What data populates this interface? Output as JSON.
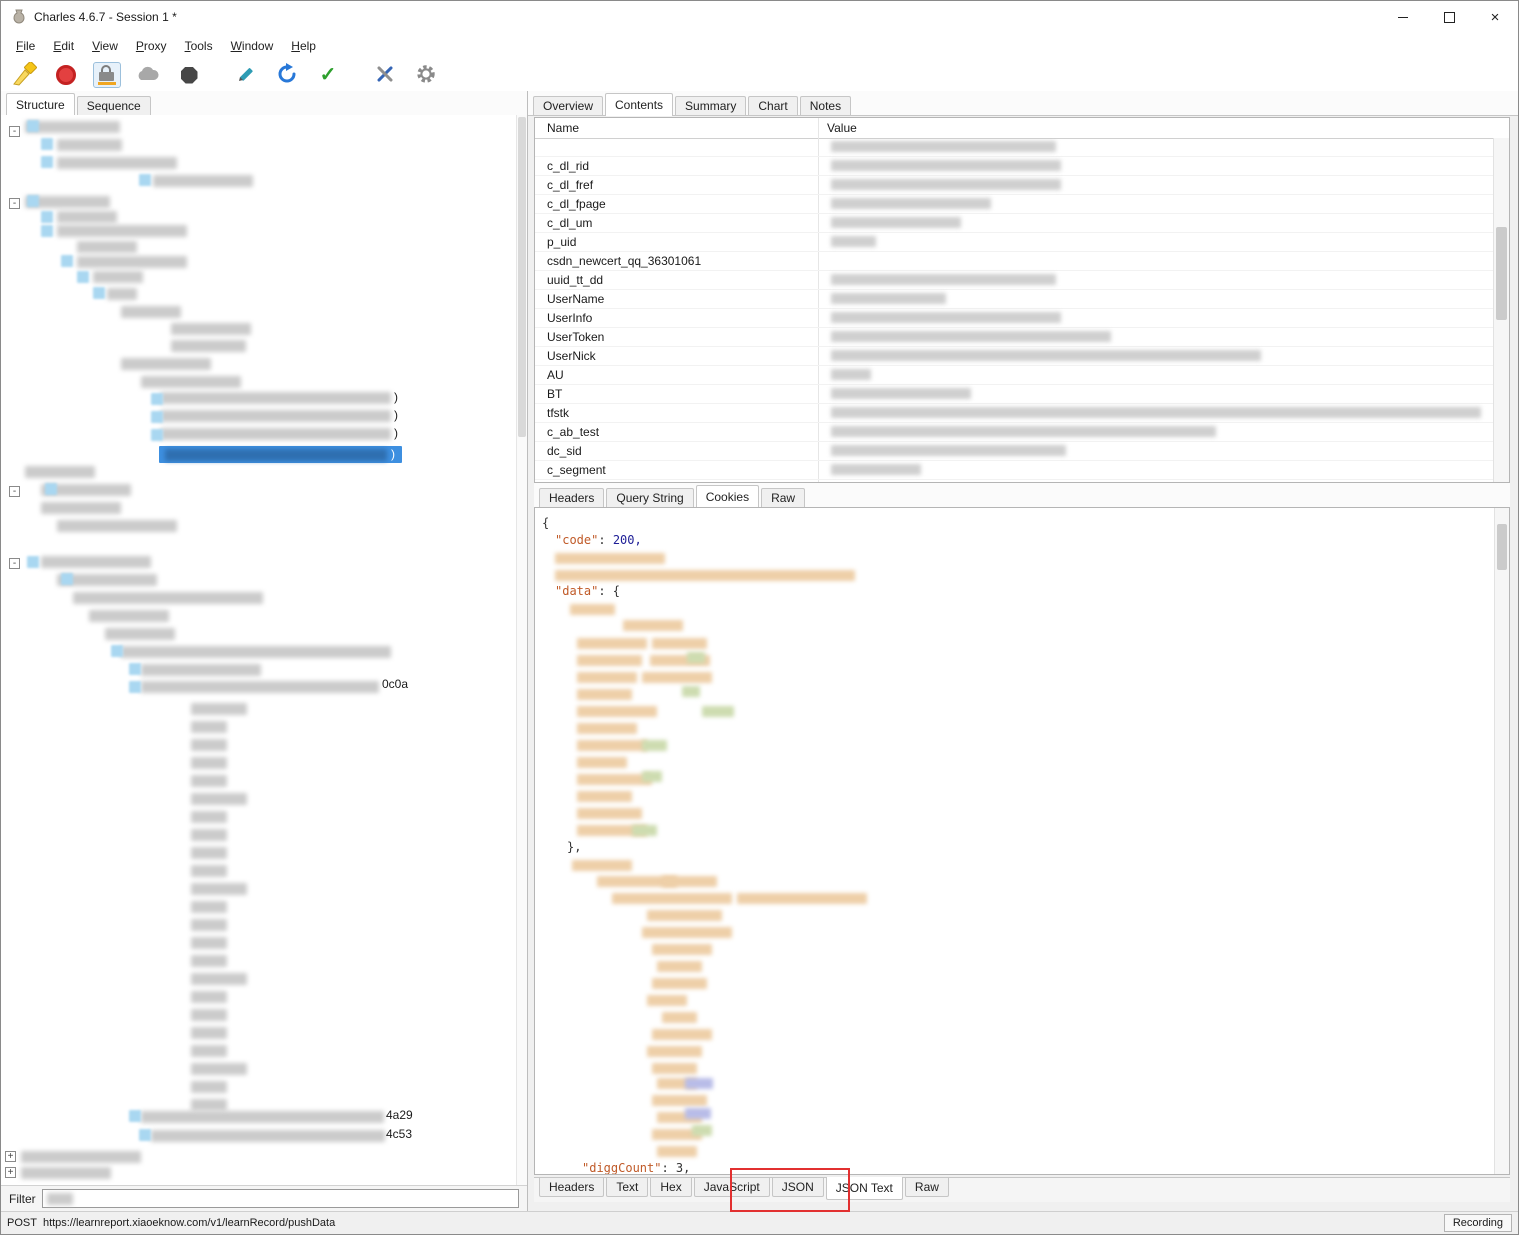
{
  "window": {
    "title": "Charles 4.6.7 - Session 1 *"
  },
  "menu": {
    "items": [
      "File",
      "Edit",
      "View",
      "Proxy",
      "Tools",
      "Window",
      "Help"
    ]
  },
  "toolbar": {
    "icons": [
      "clear-session",
      "record",
      "ssl-proxying-lock",
      "throttle",
      "breakpoints",
      "compose",
      "repeat",
      "validate",
      "tools",
      "settings"
    ]
  },
  "left_panel": {
    "tabs": [
      "Structure",
      "Sequence"
    ],
    "selected_tab": "Structure",
    "filter_label": "Filter",
    "filter_value": "",
    "fragments": {
      "paren": ")",
      "id_1": "0c0a",
      "id_2": "4a29",
      "id_3": "4c53"
    }
  },
  "right_panel": {
    "tabs": [
      "Overview",
      "Contents",
      "Summary",
      "Chart",
      "Notes"
    ],
    "selected_tab": "Contents",
    "table": {
      "columns": [
        "Name",
        "Value"
      ],
      "cookie_names": [
        "c_dl_rid",
        "c_dl_fref",
        "c_dl_fpage",
        "c_dl_um",
        "p_uid",
        "csdn_newcert_qq_36301061",
        "uuid_tt_dd",
        "UserName",
        "UserInfo",
        "UserToken",
        "UserNick",
        "AU",
        "BT",
        "tfstk",
        "c_ab_test",
        "dc_sid",
        "c_segment"
      ]
    },
    "cookie_tabs": [
      "Headers",
      "Query String",
      "Cookies",
      "Raw"
    ],
    "cookie_selected_tab": "Cookies",
    "json_view": {
      "open_brace": "{",
      "code_key": "\"code\"",
      "code_sep": ":",
      "code_value": "200,",
      "data_key": "\"data\"",
      "data_sep": ": {",
      "close_brace": "},",
      "digg_key": "\"diggCount\"",
      "digg_rest": ": 3,"
    },
    "body_tabs": [
      "Headers",
      "Text",
      "Hex",
      "JavaScript",
      "JSON",
      "JSON Text",
      "Raw"
    ],
    "body_selected_tab": "JSON Text"
  },
  "status_bar": {
    "method": "POST",
    "url": "https://learnreport.xiaoeknow.com/v1/learnRecord/pushData",
    "recording": "Recording"
  },
  "colors": {
    "selection_blue": "#3d8fe0",
    "annotation_red": "#e23030",
    "json_key_orange": "#c05a28",
    "json_value_blue": "#1d1d96",
    "ssl_lock_accent": "#f0a622"
  }
}
